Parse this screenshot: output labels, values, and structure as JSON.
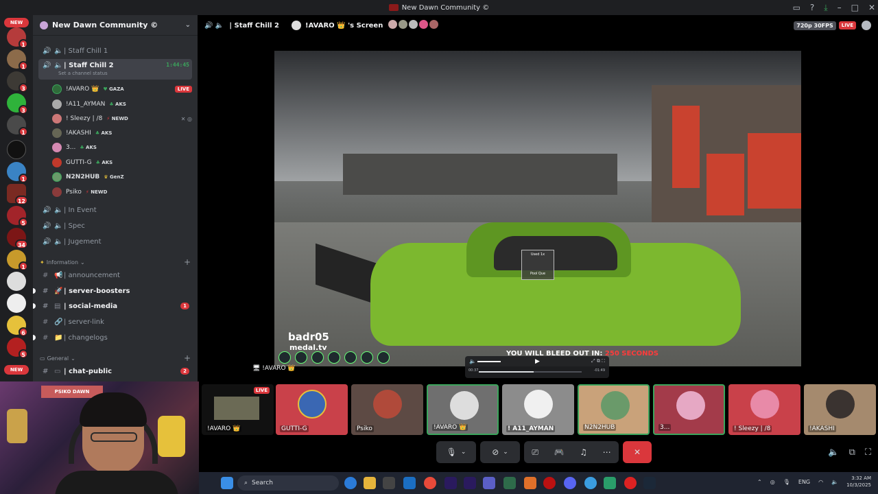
{
  "window": {
    "title": "New Dawn Community ©"
  },
  "servers": {
    "new_top": "NEW",
    "new_bottom": "NEW",
    "badges": [
      "1",
      "1",
      "3",
      "3",
      "1",
      "1",
      "1",
      "12",
      "5",
      "34",
      "1",
      "6",
      "5"
    ]
  },
  "guild": {
    "name": "New Dawn Community ©"
  },
  "channels": [
    {
      "label": "| Staff Chill 1"
    },
    {
      "label": "| Staff Chill 2",
      "time": "1:44:45",
      "status": "Set a channel status"
    },
    {
      "label": "| In Event"
    },
    {
      "label": "| Spec"
    },
    {
      "label": "| Jugement"
    }
  ],
  "voice_users": [
    {
      "name": "!AVARO 👑",
      "tag": "GAZA",
      "live": "LIVE"
    },
    {
      "name": "!A11_AYMAN",
      "tag": "AKS"
    },
    {
      "name": "! Sleezy | /8",
      "tag": "NEWD"
    },
    {
      "name": "!AKASHI",
      "tag": "AKS"
    },
    {
      "name": "3...",
      "tag": "AKS"
    },
    {
      "name": "GUTTI-G",
      "tag": "AKS"
    },
    {
      "name": "N2N2HUB",
      "tag": "GenZ"
    },
    {
      "name": "Psiko",
      "tag": "NEWD"
    }
  ],
  "category_info": "Information",
  "text_channels": [
    {
      "label": "| announcement"
    },
    {
      "label": "| server-boosters"
    },
    {
      "label": "| social-media",
      "badge": "1"
    },
    {
      "label": "| server-link"
    },
    {
      "label": "| changelogs"
    }
  ],
  "category_general": "General",
  "general_channels": [
    {
      "label": "| chat-public",
      "badge": "2"
    }
  ],
  "stage": {
    "channel": "| Staff Chill 2",
    "streamer": "!AVARO 👑 's Screen",
    "quality": "720p 30FPS",
    "live": "LIVE",
    "stream_label": "!AVARO 👑"
  },
  "video": {
    "watermark_name": "badr05",
    "watermark_site": "medal.tv",
    "bleed_text": "YOU WILL BLEED OUT IN:",
    "bleed_num": "250 SECONDS",
    "overlay": "Used 1x",
    "overlay2": "Pool Que",
    "time_start": "00:37",
    "time_end": "-01:49"
  },
  "tiles": [
    {
      "name": "!AVARO 👑",
      "live": "LIVE"
    },
    {
      "name": "GUTTI-G"
    },
    {
      "name": "Psiko"
    },
    {
      "name": "!AVARO 👑"
    },
    {
      "name": "! A11_AYMAN"
    },
    {
      "name": "N2N2HUB"
    },
    {
      "name": "3..."
    },
    {
      "name": "! Sleezy | /8"
    },
    {
      "name": "!AKASHI"
    }
  ],
  "webcam": {
    "shelf_text": "PSIKO DAWN"
  },
  "taskbar": {
    "search": "Search",
    "lang": "ENG",
    "time": "3:32 AM",
    "date": "10/3/2025"
  },
  "colors": {
    "live": "#da373c",
    "speaking": "#3ba55c",
    "sidebar": "#2b2d31",
    "rail": "#1e1f22"
  }
}
